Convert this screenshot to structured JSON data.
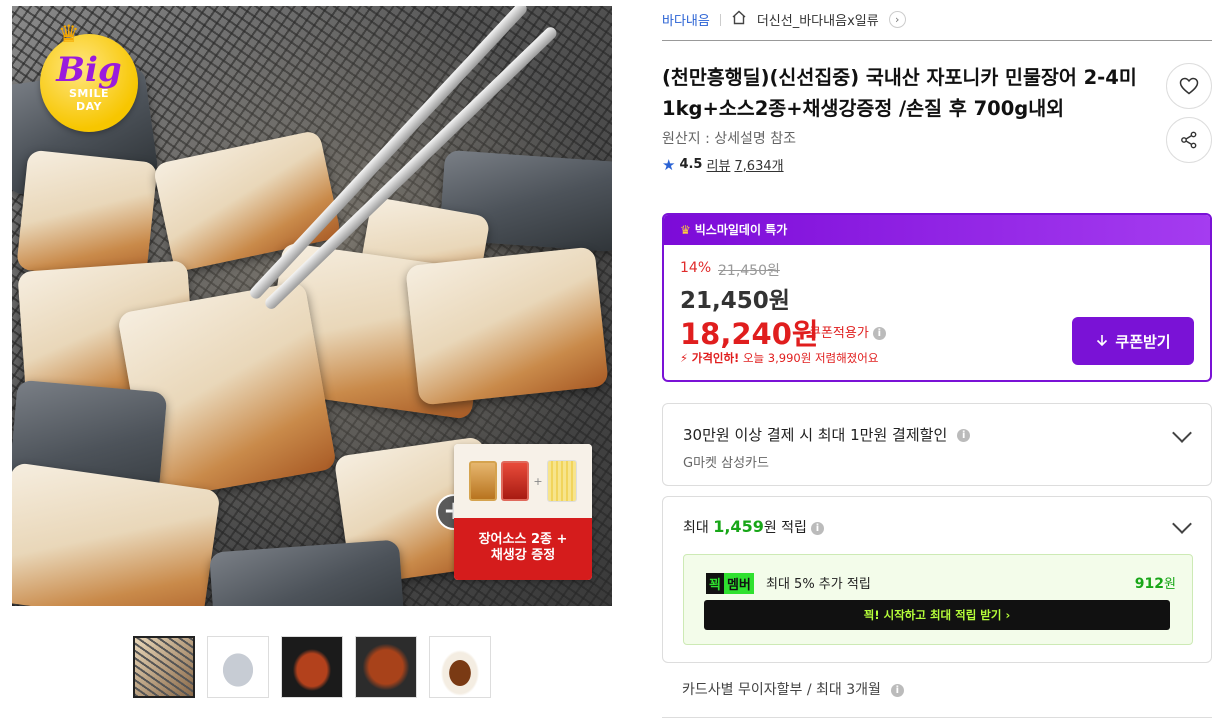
{
  "hero": {
    "badge": {
      "big": "Big",
      "line1": "SMILE",
      "line2": "DAY"
    },
    "promo_text_1": "장어소스 2종 +",
    "promo_text_2": "채생강 증정",
    "pkg1": "장어 소스",
    "pkg2": "장어 소스"
  },
  "breadcrumb": {
    "seller": "바다내음",
    "shop": "더신선_바다내음x일류"
  },
  "product": {
    "title": "(천만흥행딜)(신선집중) 국내산 자포니카 민물장어 2-4미 1kg+소스2종+채생강증정 /손질 후 700g내외",
    "origin": "원산지 : 상세설명 참조",
    "rating": "4.5",
    "reviews_label": "리뷰",
    "reviews_count": "7,634개"
  },
  "deal": {
    "header": "빅스마일데이 특가",
    "discount": "14%",
    "original_price": "21,450원",
    "price": "21,450원",
    "coupon_price": "18,240원",
    "coupon_note": "쿠폰적용가",
    "drop_bolt": "가격인하!",
    "drop_text": "오늘 3,990원 저렴해졌어요",
    "coupon_button": "쿠폰받기"
  },
  "payment": {
    "title": "30만원 이상 결제 시 최대 1만원 결제할인",
    "sub": "G마켓 삼성카드"
  },
  "points": {
    "prefix": "최대",
    "amount": "1,459",
    "suffix": "원 적립",
    "member_tag_a": "꾁",
    "member_tag_b": "멤버",
    "member_text": "최대 5% 추가 적립",
    "member_points": "912",
    "member_points_unit": "원",
    "member_button": "꾁! 시작하고 최대 적립 받기 ›"
  },
  "installment": "카드사별 무이자할부 / 최대 3개월",
  "colors": {
    "purple": "#7a12d6",
    "red": "#e01e1e",
    "green": "#18a618",
    "seller_blue": "#2a62d4"
  },
  "thumbnails": [
    "thumb-grill",
    "thumb-raw-eel",
    "thumb-sauce-eel",
    "thumb-glazed-eel",
    "thumb-sushi-eel"
  ]
}
